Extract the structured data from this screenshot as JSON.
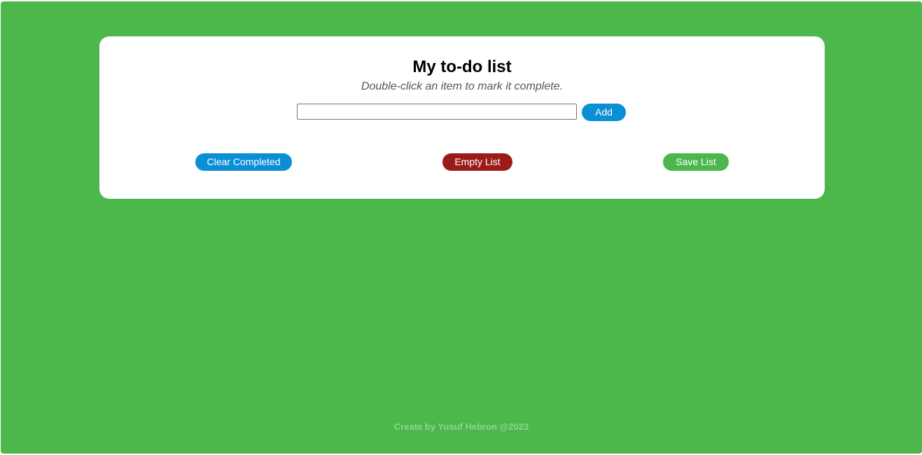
{
  "header": {
    "title": "My to-do list",
    "subtitle": "Double-click an item to mark it complete."
  },
  "form": {
    "input_value": "",
    "input_placeholder": "",
    "add_label": "Add"
  },
  "actions": {
    "clear_completed_label": "Clear Completed",
    "empty_list_label": "Empty List",
    "save_list_label": "Save List"
  },
  "footer": {
    "text": "Create by Yusuf Hebron @2023"
  },
  "colors": {
    "background": "#4cb84c",
    "card": "#ffffff",
    "primary_blue": "#0a8fd6",
    "danger_red": "#9b1b1b",
    "save_green": "#4cb84c",
    "footer_text": "#8fd48f"
  }
}
